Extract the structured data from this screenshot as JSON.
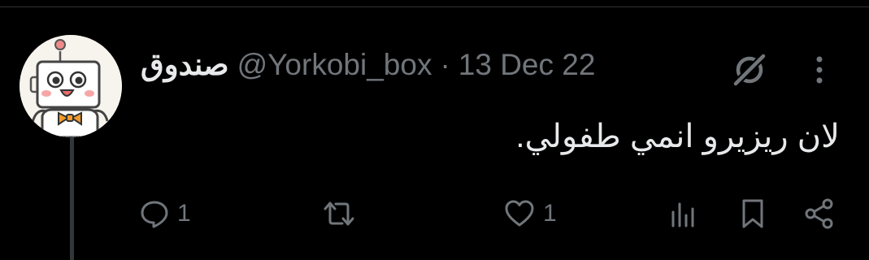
{
  "tweet": {
    "display_name": "صندوق",
    "handle": "@Yorkobi_box",
    "separator": "·",
    "date": "13 Dec 22",
    "text": "لان ريزيرو انمي طفولي.",
    "avatar_icon": "robot-box-avatar",
    "grok_icon": "grok-icon",
    "more_icon": "more-icon"
  },
  "actions": {
    "reply": {
      "icon": "reply-icon",
      "count": "1"
    },
    "retweet": {
      "icon": "retweet-icon",
      "count": ""
    },
    "like": {
      "icon": "heart-icon",
      "count": "1"
    },
    "views": {
      "icon": "views-icon"
    },
    "bookmark": {
      "icon": "bookmark-icon"
    },
    "share": {
      "icon": "share-icon"
    }
  },
  "colors": {
    "background": "#000000",
    "primary_text": "#e7e9ea",
    "secondary_text": "#71767b",
    "divider": "#2f3336",
    "thread_line": "#333639",
    "avatar_accent": "#f39a2b"
  }
}
